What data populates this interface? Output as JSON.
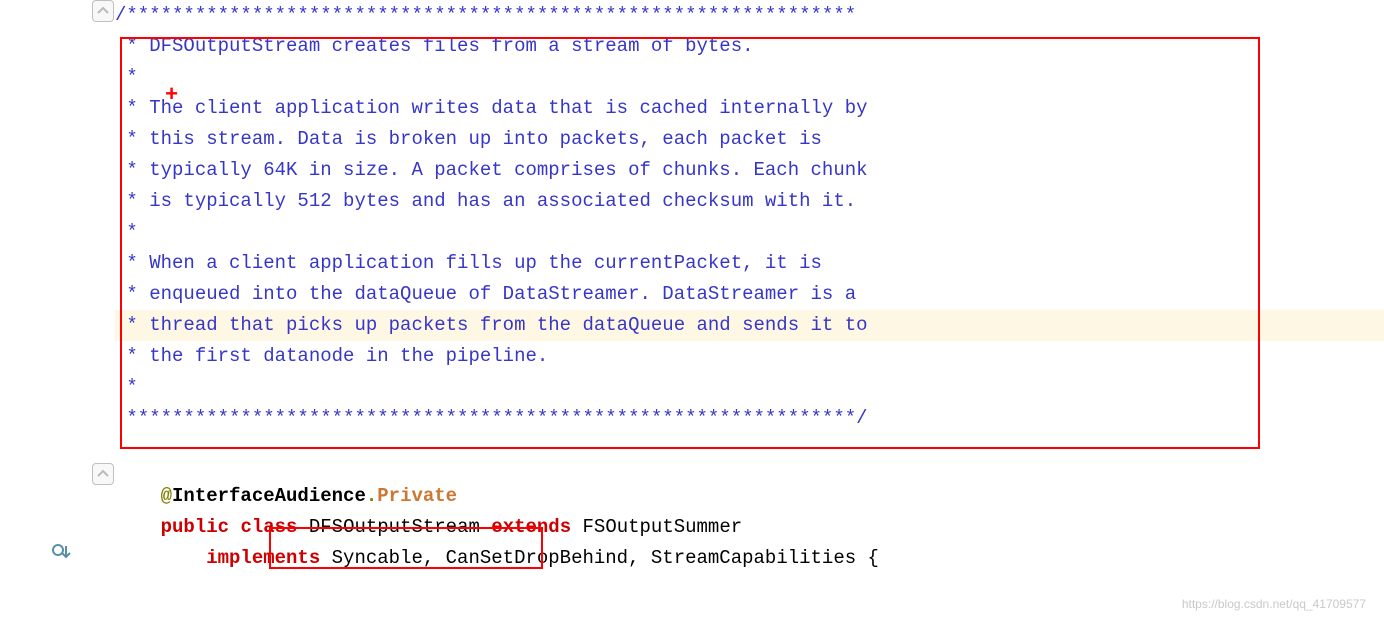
{
  "code": {
    "lines": [
      "/****************************************************************",
      " * DFSOutputStream creates files from a stream of bytes.",
      " *",
      " * The client application writes data that is cached internally by",
      " * this stream. Data is broken up into packets, each packet is",
      " * typically 64K in size. A packet comprises of chunks. Each chunk",
      " * is typically 512 bytes and has an associated checksum with it.",
      " *",
      " * When a client application fills up the currentPacket, it is",
      " * enqueued into the dataQueue of DataStreamer. DataStreamer is a",
      " * thread that picks up packets from the dataQueue and sends it to",
      " * the first datanode in the pipeline.",
      " *",
      " ****************************************************************/"
    ],
    "annotation_at": "@",
    "annotation_name": "InterfaceAudience",
    "annotation_dot": ".",
    "annotation_private": "Private",
    "decl_public": "public ",
    "decl_class": "class ",
    "decl_class_name": "DFSOutputStream ",
    "decl_extends": "extends ",
    "decl_parent": "FSOutputSummer",
    "impl_indent": "    ",
    "impl_kw": "implements ",
    "impl_list": "Syncable, CanSetDropBehind, StreamCapabilities {"
  },
  "watermark": "https://blog.csdn.net/qq_41709577",
  "annotation_plus": "+"
}
